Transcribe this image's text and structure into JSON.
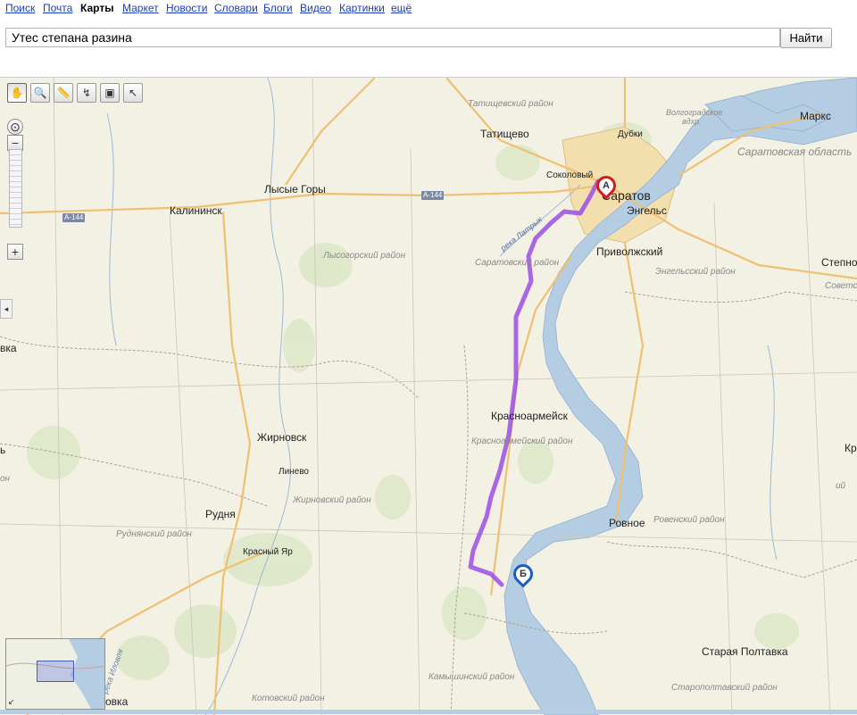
{
  "nav": {
    "items": [
      {
        "label": "Поиск"
      },
      {
        "label": "Почта"
      },
      {
        "label": "Карты",
        "active": true
      },
      {
        "label": "Маркет"
      },
      {
        "label": "Новости"
      },
      {
        "label": "Словари"
      },
      {
        "label": "Блоги"
      },
      {
        "label": "Видео"
      },
      {
        "label": "Картинки"
      },
      {
        "label": "ещё"
      }
    ]
  },
  "search": {
    "value": "Утес степана разина",
    "button_label": "Найти"
  },
  "map": {
    "toolbar": [
      {
        "name": "hand-tool-icon",
        "glyph": "✋"
      },
      {
        "name": "magnifier-tool-icon",
        "glyph": "🔍"
      },
      {
        "name": "ruler-tool-icon",
        "glyph": "📏"
      },
      {
        "name": "route-tool-icon",
        "glyph": "↯"
      },
      {
        "name": "traffic-tool-icon",
        "glyph": "▣"
      },
      {
        "name": "select-tool-icon",
        "glyph": "↖"
      }
    ],
    "zoom": {
      "in": "+",
      "out": "−",
      "locate": "⊙"
    },
    "collapse_glyph": "◂",
    "colors": {
      "land": "#f3f1e4",
      "forest": "#d9e6c3",
      "water": "#b5cde3",
      "city_fill": "#f3dfae",
      "major_road": "#f0c070",
      "route": "#9b4ee8",
      "border": "#b0a090"
    },
    "cities": [
      {
        "name": "Татищево"
      },
      {
        "name": "Дубки"
      },
      {
        "name": "Маркс"
      },
      {
        "name": "Соколовый"
      },
      {
        "name": "Саратов"
      },
      {
        "name": "Энгельс"
      },
      {
        "name": "Приволжский"
      },
      {
        "name": "Калининск"
      },
      {
        "name": "Лысые Горы"
      },
      {
        "name": "Степно"
      },
      {
        "name": "Красноармейск"
      },
      {
        "name": "Жирновск"
      },
      {
        "name": "Линево"
      },
      {
        "name": "Рудня"
      },
      {
        "name": "Красный Яр"
      },
      {
        "name": "Ровное"
      },
      {
        "name": "Старая Полтавка"
      },
      {
        "name": "вка"
      },
      {
        "name": "ь"
      },
      {
        "name": "Кр"
      },
      {
        "name": "овка"
      }
    ],
    "regions": [
      {
        "name": "Татищевский район"
      },
      {
        "name": "Волгоградское"
      },
      {
        "name": "вдхр."
      },
      {
        "name": "Саратовская область"
      },
      {
        "name": "Лысогорский район"
      },
      {
        "name": "Саратовский район"
      },
      {
        "name": "Энгельсский район"
      },
      {
        "name": "Советс"
      },
      {
        "name": "Красноармейский район"
      },
      {
        "name": "Жирновский район"
      },
      {
        "name": "Руднянский район"
      },
      {
        "name": "Ровенский район"
      },
      {
        "name": "Камышинский район"
      },
      {
        "name": "Старополтавский район"
      },
      {
        "name": "Котовский район"
      },
      {
        "name": "он"
      },
      {
        "name": "ий"
      },
      {
        "name": "река Иловля"
      }
    ],
    "roads": [
      {
        "name": "A-144"
      },
      {
        "name": "A-144"
      }
    ],
    "rivers": [
      {
        "name": "река Латрык"
      }
    ],
    "markers": {
      "a": "А",
      "b": "Б"
    },
    "minimap_corner": "↙"
  }
}
